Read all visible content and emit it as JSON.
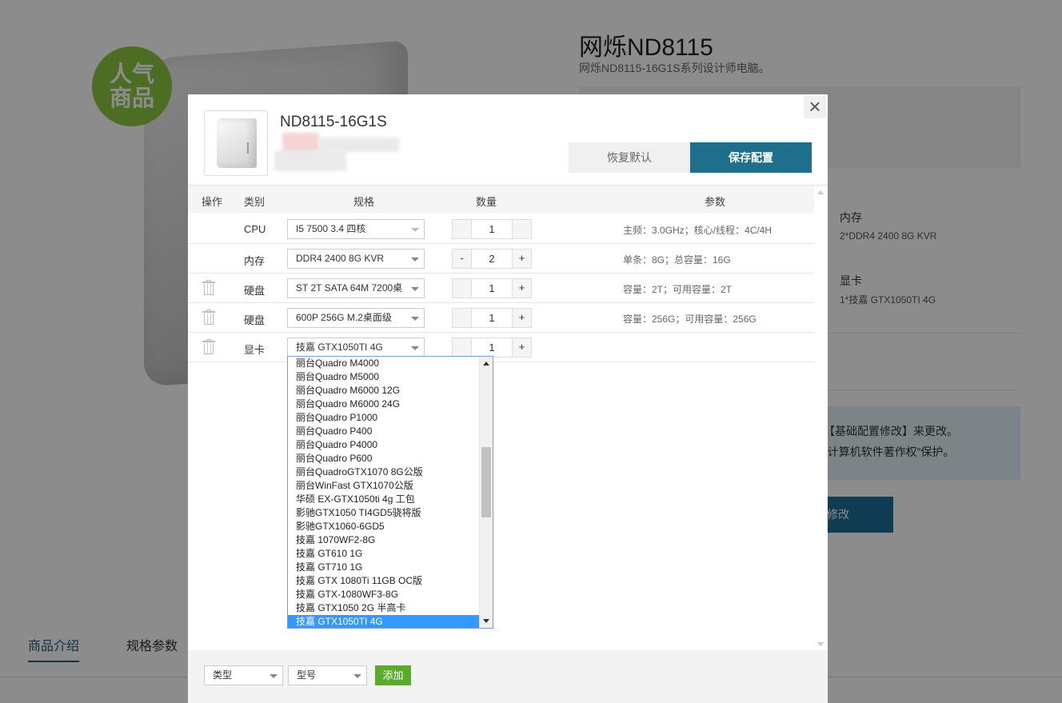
{
  "background": {
    "badge": [
      "人气",
      "商品"
    ],
    "title": "网烁ND8115",
    "subtitle": "网烁ND8115-16G1S系列设计师电脑。",
    "specs": [
      {
        "label": "内存",
        "value": "2*DDR4 2400 8G KVR"
      },
      {
        "label": "显卡",
        "value": "1*技嘉 GTX1050TI 4G"
      }
    ],
    "info_lines": [
      "【基础配置修改】来更改。",
      "“计算机软件著作权”保护。"
    ],
    "button_label": "修改",
    "tabs": [
      "商品介绍",
      "规格参数"
    ]
  },
  "modal": {
    "close_label": "×",
    "model_name": "ND8115-16G1S",
    "restore_label": "恢复默认",
    "save_label": "保存配置",
    "headers": {
      "action": "操作",
      "category": "类别",
      "spec": "规格",
      "qty": "数量",
      "params": "参数"
    },
    "rows": [
      {
        "category": "CPU",
        "spec": "I5 7500 3.4 四核",
        "qty": "1",
        "minus": "",
        "plus": "",
        "params": "主频：3.0GHz；核心/线程：4C/4H",
        "deletable": false
      },
      {
        "category": "内存",
        "spec": "DDR4 2400 8G KVR",
        "qty": "2",
        "minus": "-",
        "plus": "+",
        "params": "单条：8G；总容量：16G",
        "deletable": false
      },
      {
        "category": "硬盘",
        "spec": "ST 2T SATA 64M 7200桌",
        "qty": "1",
        "minus": "",
        "plus": "+",
        "params": "容量：2T；可用容量：2T",
        "deletable": true
      },
      {
        "category": "硬盘",
        "spec": "600P 256G M.2桌面级",
        "qty": "1",
        "minus": "",
        "plus": "+",
        "params": "容量：256G；可用容量：256G",
        "deletable": true
      },
      {
        "category": "显卡",
        "spec": "技嘉 GTX1050TI 4G",
        "qty": "1",
        "minus": "",
        "plus": "+",
        "params": "",
        "deletable": true
      }
    ],
    "dropdown_options": [
      "丽台Quadro M4000",
      "丽台Quadro M5000",
      "丽台Quadro M6000 12G",
      "丽台Quadro M6000 24G",
      "丽台Quadro P1000",
      "丽台Quadro P400",
      "丽台Quadro P4000",
      "丽台Quadro P600",
      "丽台QuadroGTX1070 8G公版",
      "丽台WinFast GTX1070公版",
      "华硕 EX-GTX1050ti 4g 工包",
      "影驰GTX1050 TI4GD5骁将版",
      "影驰GTX1060-6GD5",
      "技嘉 1070WF2-8G",
      "技嘉 GT610 1G",
      "技嘉 GT710 1G",
      "技嘉 GTX 1080Ti 11GB OC版",
      "技嘉 GTX-1080WF3-8G",
      "技嘉 GTX1050 2G 半高卡",
      "技嘉 GTX1050TI 4G"
    ],
    "dropdown_selected": "技嘉 GTX1050TI 4G",
    "footer": {
      "type_label": "类型",
      "model_label": "型号",
      "add_label": "添加"
    }
  },
  "colors": {
    "save": "#1e6f8c",
    "add": "#5aab2b",
    "selected": "#3399ff",
    "badge": "#8dc63f"
  }
}
